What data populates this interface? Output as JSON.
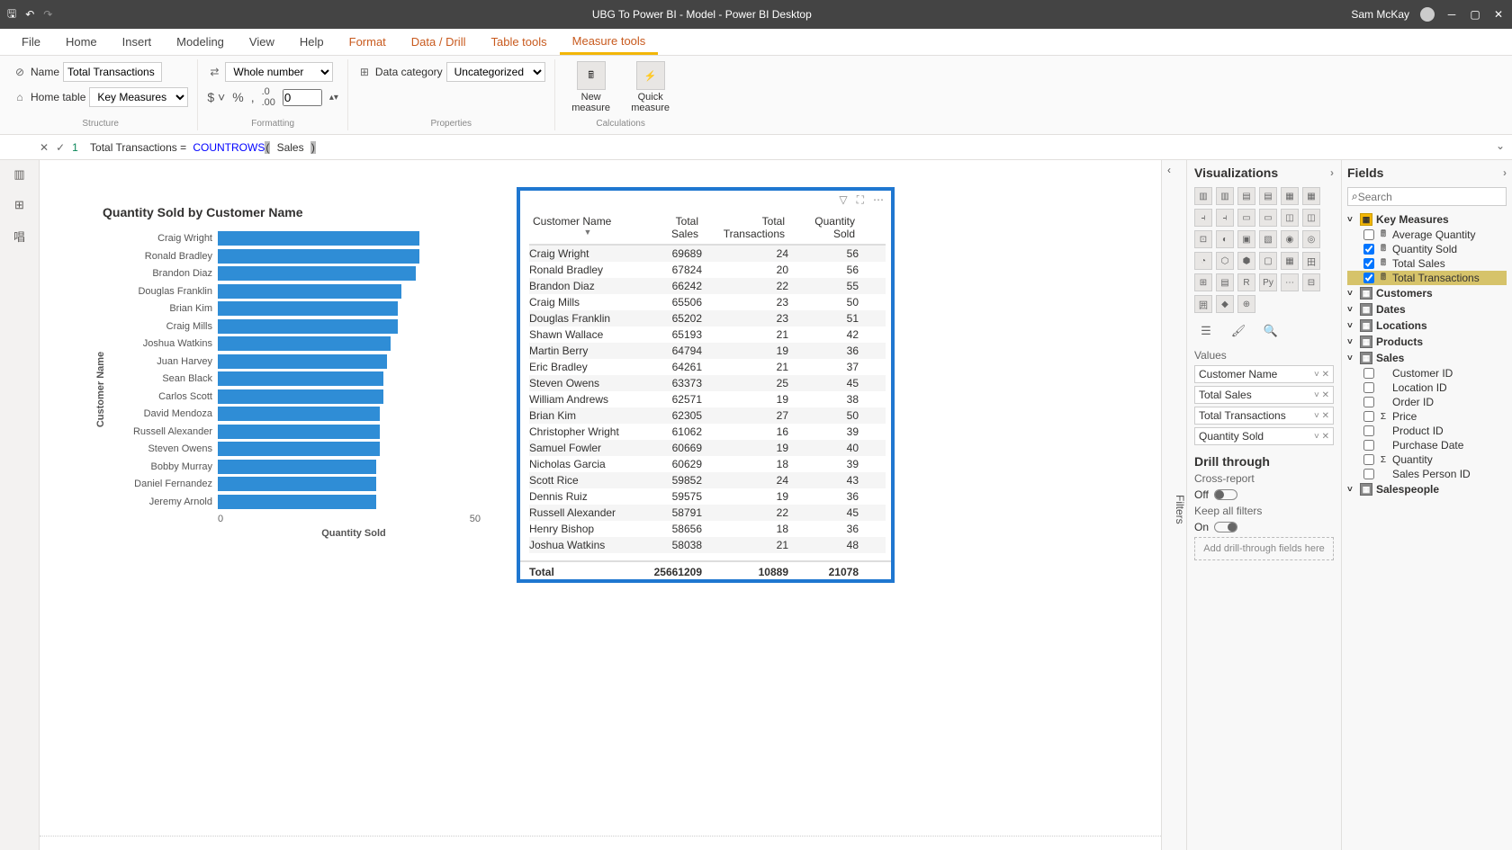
{
  "titlebar": {
    "title": "UBG To Power BI - Model - Power BI Desktop",
    "user": "Sam McKay"
  },
  "ribbon_tabs": [
    "File",
    "Home",
    "Insert",
    "Modeling",
    "View",
    "Help",
    "Format",
    "Data / Drill",
    "Table tools",
    "Measure tools"
  ],
  "ribbon": {
    "structure": {
      "name_label": "Name",
      "name_value": "Total Transactions",
      "table_label": "Home table",
      "table_value": "Key Measures",
      "group": "Structure"
    },
    "formatting": {
      "format_option": "Whole number",
      "decimal_value": "0",
      "group": "Formatting"
    },
    "properties": {
      "label": "Data category",
      "value": "Uncategorized",
      "group": "Properties"
    },
    "calculations": {
      "new_measure": "New measure",
      "quick_measure": "Quick measure",
      "group": "Calculations"
    }
  },
  "formula": {
    "line_no": "1",
    "lhs": "Total Transactions =",
    "func": "COUNTROWS",
    "arg": "Sales"
  },
  "chart_data": {
    "type": "bar",
    "title": "Quantity Sold by Customer Name",
    "xlabel": "Quantity Sold",
    "ylabel": "Customer Name",
    "categories": [
      "Craig Wright",
      "Ronald Bradley",
      "Brandon Diaz",
      "Douglas Franklin",
      "Brian Kim",
      "Craig Mills",
      "Joshua Watkins",
      "Juan Harvey",
      "Sean Black",
      "Carlos Scott",
      "David Mendoza",
      "Russell Alexander",
      "Steven Owens",
      "Bobby Murray",
      "Daniel Fernandez",
      "Jeremy Arnold"
    ],
    "values": [
      56,
      56,
      55,
      51,
      50,
      50,
      48,
      47,
      46,
      46,
      45,
      45,
      45,
      44,
      44,
      44
    ],
    "xticks": [
      "0",
      "50"
    ],
    "xlim": [
      0,
      60
    ]
  },
  "table": {
    "columns": [
      "Customer Name",
      "Total Sales",
      "Total Transactions",
      "Quantity Sold"
    ],
    "rows": [
      [
        "Craig Wright",
        "69689",
        "24",
        "56"
      ],
      [
        "Ronald Bradley",
        "67824",
        "20",
        "56"
      ],
      [
        "Brandon Diaz",
        "66242",
        "22",
        "55"
      ],
      [
        "Craig Mills",
        "65506",
        "23",
        "50"
      ],
      [
        "Douglas Franklin",
        "65202",
        "23",
        "51"
      ],
      [
        "Shawn Wallace",
        "65193",
        "21",
        "42"
      ],
      [
        "Martin Berry",
        "64794",
        "19",
        "36"
      ],
      [
        "Eric Bradley",
        "64261",
        "21",
        "37"
      ],
      [
        "Steven Owens",
        "63373",
        "25",
        "45"
      ],
      [
        "William Andrews",
        "62571",
        "19",
        "38"
      ],
      [
        "Brian Kim",
        "62305",
        "27",
        "50"
      ],
      [
        "Christopher Wright",
        "61062",
        "16",
        "39"
      ],
      [
        "Samuel Fowler",
        "60669",
        "19",
        "40"
      ],
      [
        "Nicholas Garcia",
        "60629",
        "18",
        "39"
      ],
      [
        "Scott Rice",
        "59852",
        "24",
        "43"
      ],
      [
        "Dennis Ruiz",
        "59575",
        "19",
        "36"
      ],
      [
        "Russell Alexander",
        "58791",
        "22",
        "45"
      ],
      [
        "Henry Bishop",
        "58656",
        "18",
        "36"
      ],
      [
        "Joshua Watkins",
        "58038",
        "21",
        "48"
      ]
    ],
    "total_label": "Total",
    "totals": [
      "25661209",
      "10889",
      "21078"
    ]
  },
  "viz": {
    "title": "Visualizations",
    "values_label": "Values",
    "wells": [
      "Customer Name",
      "Total Sales",
      "Total Transactions",
      "Quantity Sold"
    ],
    "drill": {
      "title": "Drill through",
      "cross": "Cross-report",
      "off": "Off",
      "keep": "Keep all filters",
      "on": "On",
      "drop": "Add drill-through fields here"
    }
  },
  "filters": {
    "label": "Filters"
  },
  "fields": {
    "title": "Fields",
    "search_placeholder": "Search",
    "tables": [
      {
        "name": "Key Measures",
        "expanded": true,
        "icon": "gold",
        "children": [
          {
            "name": "Average Quantity",
            "checked": false,
            "type": "calc"
          },
          {
            "name": "Quantity Sold",
            "checked": true,
            "type": "calc"
          },
          {
            "name": "Total Sales",
            "checked": true,
            "type": "calc"
          },
          {
            "name": "Total Transactions",
            "checked": true,
            "type": "calc",
            "highlight": true
          }
        ]
      },
      {
        "name": "Customers",
        "expanded": false,
        "icon": "plain"
      },
      {
        "name": "Dates",
        "expanded": false,
        "icon": "plain"
      },
      {
        "name": "Locations",
        "expanded": false,
        "icon": "plain"
      },
      {
        "name": "Products",
        "expanded": false,
        "icon": "plain"
      },
      {
        "name": "Sales",
        "expanded": true,
        "icon": "plain",
        "children": [
          {
            "name": "Customer ID",
            "checked": false,
            "type": "field"
          },
          {
            "name": "Location ID",
            "checked": false,
            "type": "field"
          },
          {
            "name": "Order ID",
            "checked": false,
            "type": "field"
          },
          {
            "name": "Price",
            "checked": false,
            "type": "sigma"
          },
          {
            "name": "Product ID",
            "checked": false,
            "type": "field"
          },
          {
            "name": "Purchase Date",
            "checked": false,
            "type": "field"
          },
          {
            "name": "Quantity",
            "checked": false,
            "type": "sigma"
          },
          {
            "name": "Sales Person ID",
            "checked": false,
            "type": "field"
          }
        ]
      },
      {
        "name": "Salespeople",
        "expanded": false,
        "icon": "plain"
      }
    ]
  }
}
